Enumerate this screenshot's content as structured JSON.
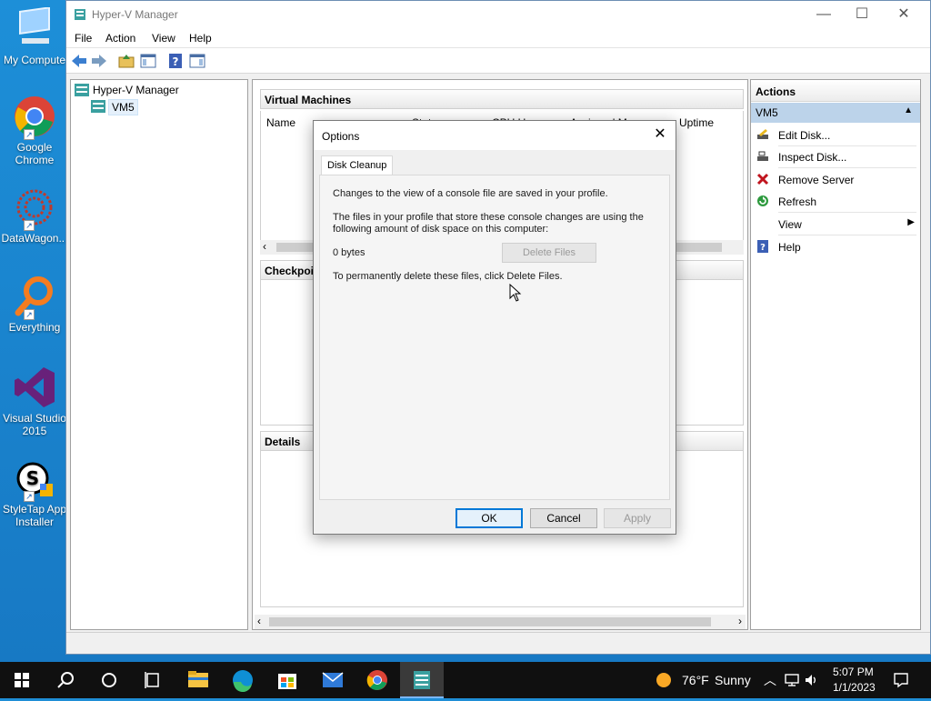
{
  "desktop": {
    "icons": [
      {
        "label": "My Compute",
        "icon": "computer-icon"
      },
      {
        "label": "Google Chrome",
        "icon": "chrome-icon"
      },
      {
        "label": "DataWagon...",
        "icon": "datawagon-icon"
      },
      {
        "label": "Everything",
        "icon": "everything-icon"
      },
      {
        "label": "Visual Studio 2015",
        "icon": "visual-studio-icon"
      },
      {
        "label": "StyleTap App Installer",
        "icon": "styletap-icon"
      }
    ]
  },
  "window": {
    "title": "Hyper-V Manager",
    "controls": {
      "minimize": "—",
      "maximize": "☐",
      "close": "✕"
    },
    "menu": [
      "File",
      "Action",
      "View",
      "Help"
    ],
    "tree": {
      "root": "Hyper-V Manager",
      "child": "VM5"
    },
    "center": {
      "virtual_machines_header": "Virtual Machines",
      "columns": [
        "Name",
        "State",
        "CPU Usage",
        "Assigned Memory",
        "Uptime"
      ],
      "checkpoints_header": "Checkpoints",
      "details_header": "Details"
    },
    "actions": {
      "header": "Actions",
      "group": "VM5",
      "items": [
        {
          "label": "Edit Disk...",
          "icon": "edit-disk-icon"
        },
        {
          "label": "Inspect Disk...",
          "icon": "inspect-disk-icon"
        },
        {
          "label": "Remove Server",
          "icon": "remove-icon"
        },
        {
          "label": "Refresh",
          "icon": "refresh-icon"
        },
        {
          "label": "View",
          "icon": "submenu-arrow-icon"
        },
        {
          "label": "Help",
          "icon": "help-icon"
        }
      ]
    }
  },
  "dialog": {
    "title": "Options",
    "tab": "Disk Cleanup",
    "line1": "Changes to the view of a console file are saved in your profile.",
    "line2a": "The files in your profile that store these console changes are using the",
    "line2b": "following amount of disk space on this computer:",
    "size": "0 bytes",
    "delete_button": "Delete Files",
    "line3": "To permanently delete these files, click Delete Files.",
    "ok": "OK",
    "cancel": "Cancel",
    "apply": "Apply"
  },
  "taskbar": {
    "weather_temp": "76°F",
    "weather_text": "Sunny",
    "time": "5:07 PM",
    "date": "1/1/2023"
  },
  "colors": {
    "desktop": "#1d8fd8",
    "accent": "#0078d7",
    "actions_group_bg": "#bcd3ea"
  }
}
